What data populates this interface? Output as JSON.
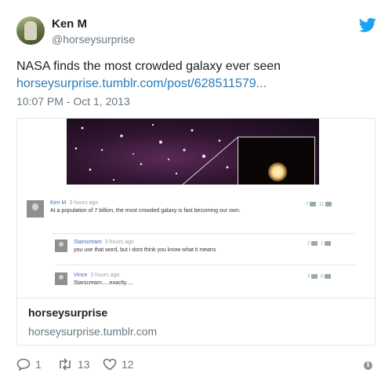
{
  "tweet": {
    "author_name": "Ken M",
    "author_handle": "@horseysurprise",
    "text": "NASA finds the most crowded galaxy ever seen",
    "link": "horseysurprise.tumblr.com/post/628511579...",
    "timestamp": "10:07 PM - Oct 1, 2013"
  },
  "card": {
    "title": "horseysurprise",
    "domain": "horseysurprise.tumblr.com",
    "comments": [
      {
        "author": "Ken M",
        "ago": "3 hours ago",
        "body": "At a population of 7 billion, the most crowded galaxy is fast becoming our own.",
        "up": "7",
        "down": "11"
      },
      {
        "author": "Starscream",
        "ago": "3 hours ago",
        "body": "you use that word, but i dont think you know what it means",
        "up": "2",
        "down": "1"
      },
      {
        "author": "Vince",
        "ago": "3 hours ago",
        "body": "Starscream.....exactly.....",
        "up": "3",
        "down": "0"
      }
    ]
  },
  "actions": {
    "replies": "1",
    "retweets": "13",
    "likes": "12"
  },
  "icons": {
    "brand": "twitter-bird-icon",
    "reply": "reply-icon",
    "retweet": "retweet-icon",
    "like": "heart-icon",
    "info": "info-icon"
  },
  "colors": {
    "link": "#2b7bb9",
    "muted": "#697882",
    "twitter_blue": "#1da1f2"
  }
}
